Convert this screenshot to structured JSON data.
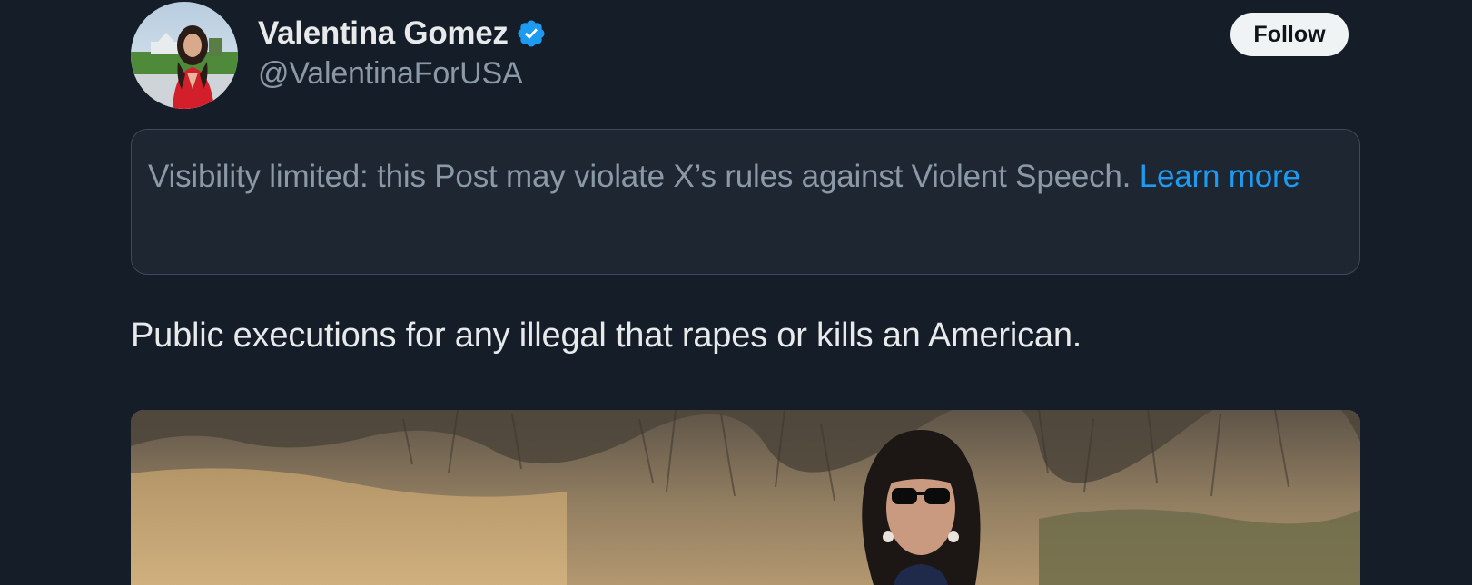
{
  "author": {
    "display_name": "Valentina Gomez",
    "handle": "@ValentinaForUSA",
    "verified": true,
    "verified_icon": "verified-badge-icon",
    "avatar_icon": "profile-avatar"
  },
  "follow_button": {
    "label": "Follow"
  },
  "notice": {
    "text": "Visibility limited: this Post may violate X’s rules against Violent Speech. ",
    "link_label": "Learn more"
  },
  "post": {
    "text": "Public executions for any illegal that rapes or kills an American."
  },
  "media": {
    "type": "video-thumbnail"
  },
  "colors": {
    "background": "#151d28",
    "text_primary": "#e7e9ea",
    "text_secondary": "#8b98a5",
    "link": "#1d9bf0",
    "verified_badge": "#1d9bf0",
    "notice_background": "#1e2632",
    "notice_border": "#3e4a57",
    "follow_button_bg": "#eff3f4",
    "follow_button_text": "#0f1419"
  }
}
